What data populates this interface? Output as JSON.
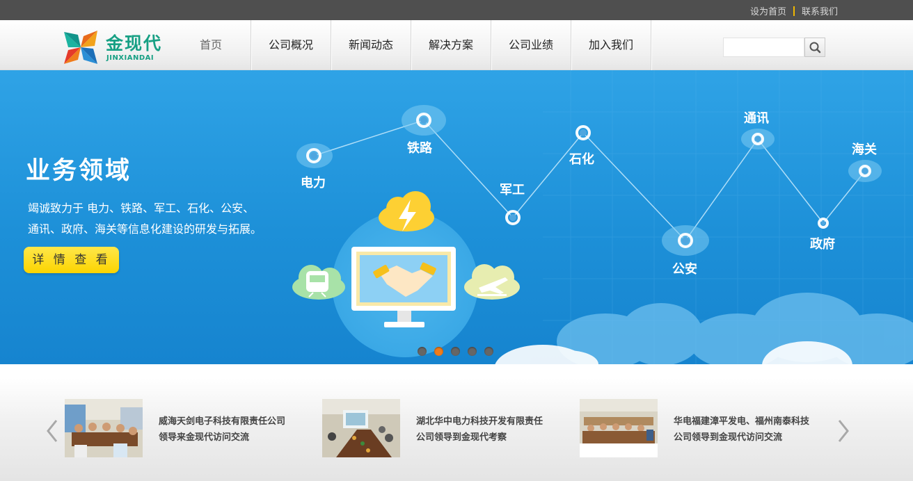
{
  "topbar": {
    "set_home": "设为首页",
    "contact": "联系我们"
  },
  "header": {
    "logo_cn": "金现代",
    "logo_en": "JINXIANDAI",
    "nav": [
      {
        "label": "首页"
      },
      {
        "label": "公司概况"
      },
      {
        "label": "新闻动态"
      },
      {
        "label": "解决方案"
      },
      {
        "label": "公司业绩"
      },
      {
        "label": "加入我们"
      }
    ],
    "search_value": ""
  },
  "banner": {
    "title": "业务领域",
    "desc_line1": "竭诚致力于 电力、铁路、军工、石化、公安、",
    "desc_line2": "通讯、政府、海关等信息化建设的研发与拓展。",
    "button": "详 情 查 看",
    "nodes": [
      "电力",
      "铁路",
      "军工",
      "石化",
      "公安",
      "通讯",
      "政府",
      "海关"
    ],
    "active_slide": 2,
    "slide_count": 5
  },
  "news": [
    {
      "line1": "威海天剑电子科技有限责任公司",
      "line2": "领导来金现代访问交流"
    },
    {
      "line1": "湖北华中电力科技开发有限责任",
      "line2": "公司领导到金现代考察"
    },
    {
      "line1": "华电福建漳平发电、福州南泰科技",
      "line2": "公司领导到金现代访问交流"
    }
  ],
  "colors": {
    "brand": "#17a084",
    "banner_blue": "#1d90d8",
    "accent_yellow": "#fcd400",
    "active_dot": "#f07c1b"
  }
}
